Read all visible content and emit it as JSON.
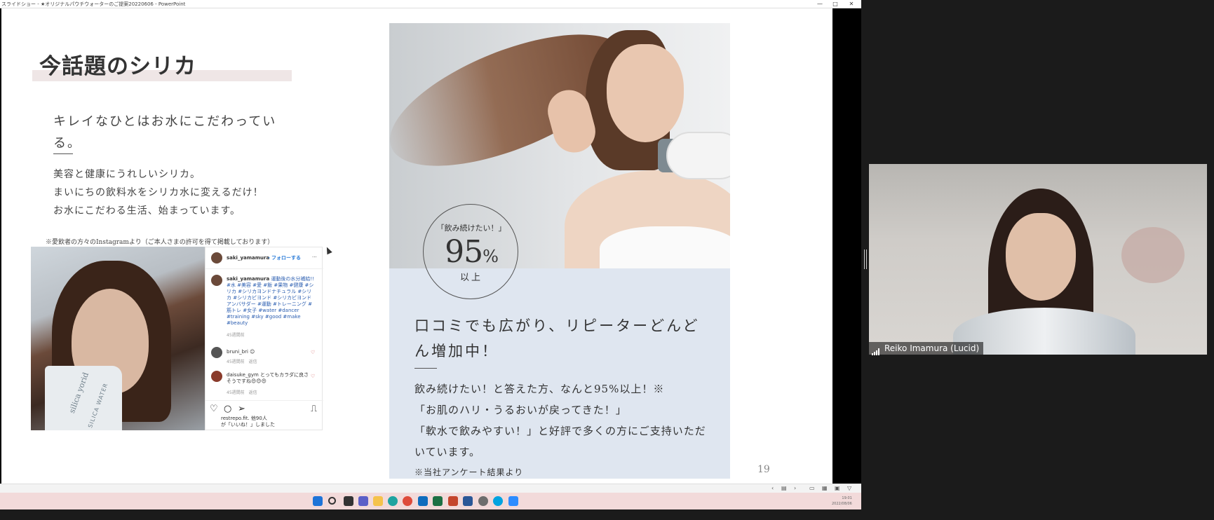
{
  "window": {
    "title": "スライドショー - ★オリジナルパウチウォーターのご提案20220606 - PowerPoint",
    "controls": [
      "—",
      "□",
      "✕"
    ]
  },
  "slide": {
    "title": "今話題のシリカ",
    "left_heading": "キレイなひとはお水にこだわっている。",
    "left_body": [
      "美容と健康にうれしいシリカ。",
      "まいにちの飲料水をシリカ水に変えるだけ！",
      "お水にこだわる生活、始まっています。"
    ],
    "ig_note": "※愛飲者の方々のInstagramより（ご本人さまの許可を得て掲載しております）",
    "instagram": {
      "user": "saki_yamamura",
      "follow": "・フォローする",
      "more": "···",
      "caption_user": "saki_yamamura",
      "caption": "運動後の水分補給!! #水 #美容 #愛 #飯 #果物 #健康 #シリカ #シリカヨンドナチュラル #シリカ #シリカビヨンド #シリカビヨンドアンバサダー #運動 #トレーニング #筋トレ #女子 #water #dancer #training #sky #good #make #beauty",
      "caption_time": "45週間前",
      "comment1_user": "bruni_bri",
      "comment1_text": "☺",
      "comment1_time": "45週間前　返信",
      "comment2_user": "daisuke_gym",
      "comment2_text": "とってもカラダに良さそうですね😍😊😍",
      "comment2_time": "45週間前　返信",
      "likes_user": "restrepo.fit.",
      "likes_count": "他90人",
      "likes_text": "が「いいね！」しました",
      "pouch_brand": "silica yorid",
      "pouch_sub": "SILICA WATER"
    },
    "badge": {
      "top": "「飲み続けたい！」",
      "number": "95",
      "percent": "%",
      "bottom": "以上"
    },
    "right_heading": "口コミでも広がり、リピーターどんどん増加中！",
    "right_body": [
      "飲み続けたい！と答えた方、なんと95%以上！※",
      "「お肌のハリ・うるおいが戻ってきた！」",
      "「軟水で飲みやすい！」と好評で多くの方にご支持いただいています。"
    ],
    "right_footnote": "※当社アンケート結果より",
    "page_number": "19"
  },
  "status_bar": {
    "prev": "‹",
    "slide_indicator": "▤",
    "next": "›"
  },
  "taskbar": {
    "clock_time": "19:01",
    "clock_date": "2022/08/06",
    "icons": [
      "windows-icon",
      "search-icon",
      "task-view-icon",
      "teams-icon",
      "file-explorer-icon",
      "edge-icon",
      "chrome-icon",
      "outlook-icon",
      "excel-icon",
      "powerpoint-icon",
      "word-icon",
      "settings-icon",
      "skype-icon",
      "zoom-icon"
    ]
  },
  "video": {
    "participant_name": "Reiko Imamura (Lucid)"
  }
}
